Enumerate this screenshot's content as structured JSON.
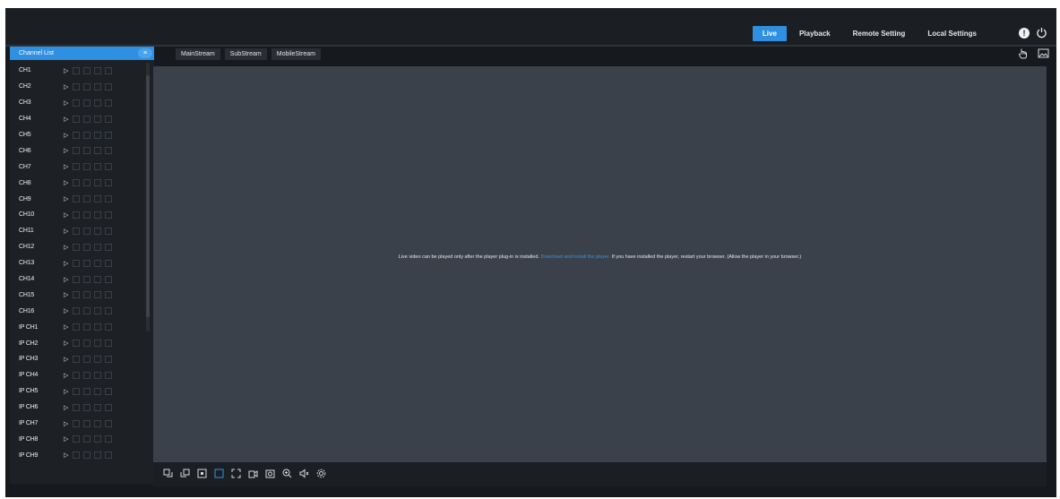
{
  "nav": {
    "items": [
      {
        "label": "Live",
        "active": true
      },
      {
        "label": "Playback",
        "active": false
      },
      {
        "label": "Remote Setting",
        "active": false
      },
      {
        "label": "Local Settings",
        "active": false
      }
    ],
    "accent_color": "#2f8fe0"
  },
  "top_icons": [
    "info-icon",
    "power-icon"
  ],
  "sidebar": {
    "header_label": "Channel List",
    "channels": [
      {
        "name": "CH1"
      },
      {
        "name": "CH2"
      },
      {
        "name": "CH3"
      },
      {
        "name": "CH4"
      },
      {
        "name": "CH5"
      },
      {
        "name": "CH6"
      },
      {
        "name": "CH7"
      },
      {
        "name": "CH8"
      },
      {
        "name": "CH9"
      },
      {
        "name": "CH10"
      },
      {
        "name": "CH11"
      },
      {
        "name": "CH12"
      },
      {
        "name": "CH13"
      },
      {
        "name": "CH14"
      },
      {
        "name": "CH15"
      },
      {
        "name": "CH16"
      },
      {
        "name": "IP CH1"
      },
      {
        "name": "IP CH2"
      },
      {
        "name": "IP CH3"
      },
      {
        "name": "IP CH4"
      },
      {
        "name": "IP CH5"
      },
      {
        "name": "IP CH6"
      },
      {
        "name": "IP CH7"
      },
      {
        "name": "IP CH8"
      },
      {
        "name": "IP CH9"
      }
    ]
  },
  "stream_tabs": [
    "MainStream",
    "SubStream",
    "MobileStream"
  ],
  "main": {
    "message_before": "Live video can be played only after the player plug-in is installed.",
    "message_link": "Download and install the player.",
    "message_after": "If you have installed the player, restart your browser. (Allow the player in your browser.)"
  },
  "toolbar_icons": [
    "previous-page-icon",
    "next-page-icon",
    "single-view-icon",
    "quad-view-icon",
    "fullscreen-icon",
    "record-icon",
    "snapshot-icon",
    "zoom-icon",
    "volume-icon",
    "settings-icon"
  ]
}
